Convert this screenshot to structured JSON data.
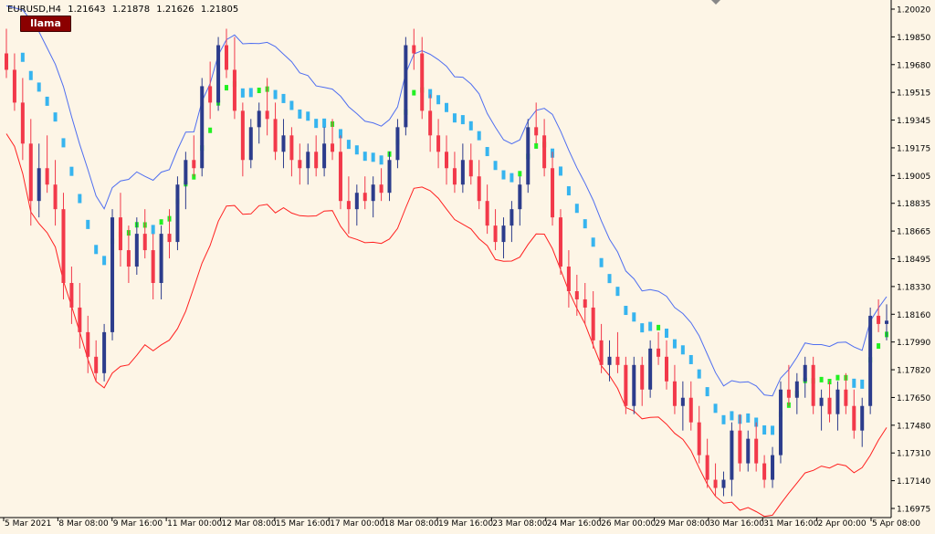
{
  "chart_data": {
    "type": "candlestick",
    "symbol": "EURUSD,H4",
    "ohlc_readout": [
      "1.21643",
      "1.21878",
      "1.21626",
      "1.21805"
    ],
    "indicator_badge": "llama",
    "y_ticks": [
      "1.20020",
      "1.19850",
      "1.19680",
      "1.19515",
      "1.19345",
      "1.19175",
      "1.19005",
      "1.18835",
      "1.18665",
      "1.18495",
      "1.18330",
      "1.18160",
      "1.17990",
      "1.17820",
      "1.17650",
      "1.17480",
      "1.17310",
      "1.17140",
      "1.16975"
    ],
    "ylim": [
      1.16975,
      1.2002
    ],
    "x_ticks": [
      "5 Mar 2021",
      "8 Mar 08:00",
      "9 Mar 16:00",
      "11 Mar 00:00",
      "12 Mar 08:00",
      "15 Mar 16:00",
      "17 Mar 00:00",
      "18 Mar 08:00",
      "19 Mar 16:00",
      "23 Mar 08:00",
      "24 Mar 16:00",
      "26 Mar 00:00",
      "29 Mar 08:00",
      "30 Mar 16:00",
      "31 Mar 16:00",
      "2 Apr 00:00",
      "5 Apr 08:00"
    ],
    "colors": {
      "background": "#fdf5e6",
      "bull": "#2c3c8c",
      "bear": "#f2394a",
      "upper_band": "#4f6ef0",
      "lower_band": "#ff2020",
      "trend_down": "#36b4ef",
      "trend_up": "#22f022"
    },
    "candles": [
      [
        1.1975,
        1.199,
        1.196,
        1.1965
      ],
      [
        1.1965,
        1.1975,
        1.194,
        1.1945
      ],
      [
        1.1945,
        1.196,
        1.191,
        1.192
      ],
      [
        1.192,
        1.1935,
        1.187,
        1.1885
      ],
      [
        1.1885,
        1.192,
        1.1875,
        1.1905
      ],
      [
        1.1905,
        1.1925,
        1.189,
        1.1895
      ],
      [
        1.1895,
        1.191,
        1.187,
        1.188
      ],
      [
        1.188,
        1.189,
        1.1825,
        1.1835
      ],
      [
        1.1835,
        1.1845,
        1.181,
        1.182
      ],
      [
        1.182,
        1.1835,
        1.1795,
        1.1805
      ],
      [
        1.1805,
        1.1815,
        1.178,
        1.179
      ],
      [
        1.179,
        1.18,
        1.1775,
        1.178
      ],
      [
        1.178,
        1.181,
        1.1775,
        1.1805
      ],
      [
        1.1805,
        1.188,
        1.18,
        1.1875
      ],
      [
        1.1875,
        1.189,
        1.1845,
        1.1855
      ],
      [
        1.1855,
        1.187,
        1.1835,
        1.1845
      ],
      [
        1.1845,
        1.1875,
        1.184,
        1.1865
      ],
      [
        1.1865,
        1.188,
        1.185,
        1.1855
      ],
      [
        1.1855,
        1.1865,
        1.1825,
        1.1835
      ],
      [
        1.1835,
        1.187,
        1.1825,
        1.1865
      ],
      [
        1.1865,
        1.188,
        1.185,
        1.186
      ],
      [
        1.186,
        1.19,
        1.1855,
        1.1895
      ],
      [
        1.1895,
        1.1915,
        1.188,
        1.191
      ],
      [
        1.191,
        1.1925,
        1.19,
        1.1905
      ],
      [
        1.1905,
        1.196,
        1.19,
        1.1955
      ],
      [
        1.1955,
        1.197,
        1.1935,
        1.1945
      ],
      [
        1.1945,
        1.1985,
        1.194,
        1.198
      ],
      [
        1.198,
        1.199,
        1.196,
        1.1965
      ],
      [
        1.1965,
        1.1985,
        1.1935,
        1.194
      ],
      [
        1.194,
        1.1945,
        1.19,
        1.191
      ],
      [
        1.191,
        1.1935,
        1.1905,
        1.193
      ],
      [
        1.193,
        1.1945,
        1.192,
        1.194
      ],
      [
        1.194,
        1.196,
        1.1925,
        1.1935
      ],
      [
        1.1935,
        1.1945,
        1.191,
        1.1915
      ],
      [
        1.1915,
        1.1935,
        1.1905,
        1.1925
      ],
      [
        1.1925,
        1.193,
        1.19,
        1.191
      ],
      [
        1.191,
        1.192,
        1.1895,
        1.1905
      ],
      [
        1.1905,
        1.192,
        1.1895,
        1.1915
      ],
      [
        1.1915,
        1.1925,
        1.19,
        1.1905
      ],
      [
        1.1905,
        1.193,
        1.19,
        1.192
      ],
      [
        1.192,
        1.1935,
        1.191,
        1.1915
      ],
      [
        1.1915,
        1.1925,
        1.188,
        1.1885
      ],
      [
        1.1885,
        1.19,
        1.1865,
        1.188
      ],
      [
        1.188,
        1.1895,
        1.187,
        1.189
      ],
      [
        1.189,
        1.19,
        1.188,
        1.1885
      ],
      [
        1.1885,
        1.19,
        1.1875,
        1.1895
      ],
      [
        1.1895,
        1.1905,
        1.1885,
        1.189
      ],
      [
        1.189,
        1.1915,
        1.1885,
        1.191
      ],
      [
        1.191,
        1.1935,
        1.1905,
        1.193
      ],
      [
        1.193,
        1.1985,
        1.1925,
        1.198
      ],
      [
        1.198,
        1.199,
        1.1965,
        1.1975
      ],
      [
        1.1975,
        1.1985,
        1.1935,
        1.194
      ],
      [
        1.194,
        1.195,
        1.1915,
        1.1925
      ],
      [
        1.1925,
        1.1935,
        1.1905,
        1.1915
      ],
      [
        1.1915,
        1.1925,
        1.1895,
        1.1905
      ],
      [
        1.1905,
        1.1915,
        1.189,
        1.1895
      ],
      [
        1.1895,
        1.192,
        1.189,
        1.191
      ],
      [
        1.191,
        1.192,
        1.1895,
        1.19
      ],
      [
        1.19,
        1.191,
        1.188,
        1.1885
      ],
      [
        1.1885,
        1.1895,
        1.1865,
        1.187
      ],
      [
        1.187,
        1.188,
        1.1855,
        1.186
      ],
      [
        1.186,
        1.1875,
        1.185,
        1.187
      ],
      [
        1.187,
        1.1885,
        1.186,
        1.188
      ],
      [
        1.188,
        1.19,
        1.187,
        1.1895
      ],
      [
        1.1895,
        1.1935,
        1.189,
        1.193
      ],
      [
        1.193,
        1.1945,
        1.192,
        1.1925
      ],
      [
        1.1925,
        1.1935,
        1.19,
        1.1905
      ],
      [
        1.1905,
        1.1915,
        1.187,
        1.1875
      ],
      [
        1.1875,
        1.188,
        1.184,
        1.1845
      ],
      [
        1.1845,
        1.1855,
        1.182,
        1.183
      ],
      [
        1.183,
        1.184,
        1.1815,
        1.1825
      ],
      [
        1.1825,
        1.1835,
        1.181,
        1.182
      ],
      [
        1.182,
        1.183,
        1.1795,
        1.18
      ],
      [
        1.18,
        1.181,
        1.178,
        1.1785
      ],
      [
        1.1785,
        1.18,
        1.1775,
        1.179
      ],
      [
        1.179,
        1.1805,
        1.178,
        1.1785
      ],
      [
        1.1785,
        1.179,
        1.1755,
        1.176
      ],
      [
        1.176,
        1.179,
        1.1755,
        1.1785
      ],
      [
        1.1785,
        1.179,
        1.176,
        1.177
      ],
      [
        1.177,
        1.18,
        1.1765,
        1.1795
      ],
      [
        1.1795,
        1.1805,
        1.1785,
        1.179
      ],
      [
        1.179,
        1.18,
        1.177,
        1.1775
      ],
      [
        1.1775,
        1.1785,
        1.1755,
        1.176
      ],
      [
        1.176,
        1.1775,
        1.1745,
        1.1765
      ],
      [
        1.1765,
        1.1775,
        1.1745,
        1.175
      ],
      [
        1.175,
        1.176,
        1.1725,
        1.173
      ],
      [
        1.173,
        1.174,
        1.171,
        1.1715
      ],
      [
        1.1715,
        1.1725,
        1.1705,
        1.171
      ],
      [
        1.171,
        1.172,
        1.1705,
        1.1715
      ],
      [
        1.1715,
        1.175,
        1.1705,
        1.1745
      ],
      [
        1.1745,
        1.1755,
        1.172,
        1.1725
      ],
      [
        1.1725,
        1.1745,
        1.172,
        1.174
      ],
      [
        1.174,
        1.175,
        1.172,
        1.1725
      ],
      [
        1.1725,
        1.173,
        1.171,
        1.1715
      ],
      [
        1.1715,
        1.1735,
        1.171,
        1.173
      ],
      [
        1.173,
        1.1775,
        1.1725,
        1.177
      ],
      [
        1.177,
        1.1785,
        1.176,
        1.1765
      ],
      [
        1.1765,
        1.178,
        1.1755,
        1.1775
      ],
      [
        1.1775,
        1.179,
        1.1765,
        1.1785
      ],
      [
        1.1785,
        1.179,
        1.1755,
        1.176
      ],
      [
        1.176,
        1.177,
        1.1745,
        1.1765
      ],
      [
        1.1765,
        1.1775,
        1.175,
        1.1755
      ],
      [
        1.1755,
        1.1775,
        1.1745,
        1.177
      ],
      [
        1.177,
        1.178,
        1.1755,
        1.176
      ],
      [
        1.176,
        1.177,
        1.174,
        1.1745
      ],
      [
        1.1745,
        1.1765,
        1.1735,
        1.176
      ],
      [
        1.176,
        1.182,
        1.1755,
        1.1815
      ],
      [
        1.1815,
        1.1825,
        1.1805,
        1.181
      ],
      [
        1.181,
        1.1822,
        1.18,
        1.1812
      ]
    ]
  }
}
